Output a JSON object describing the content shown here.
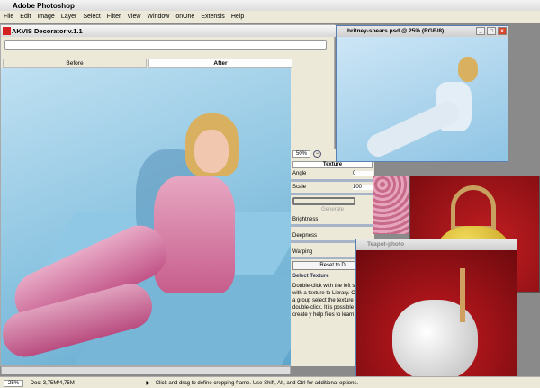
{
  "app_title": "Adobe Photoshop",
  "menu": [
    "File",
    "Edit",
    "Image",
    "Layer",
    "Select",
    "Filter",
    "View",
    "Window",
    "onOne",
    "Extensis",
    "Help"
  ],
  "plugin": {
    "title": "AKVIS Decorator v.1.1",
    "tabs": [
      "Before",
      "After"
    ],
    "zoom": "50%",
    "panel_tab": "Texture",
    "angle_label": "Angle",
    "angle_value": "0",
    "scale_label": "Scale",
    "scale_value": "100",
    "generate": "Generate",
    "brightness": "Brightness",
    "deepness": "Deepness",
    "warping": "Warping",
    "reset": "Reset to D",
    "help_title": "Select Texture",
    "help_text": "Double-click with the left square with a texture to Library. Choose a group select the texture you li double-click. It is possible to create y help files to learn how."
  },
  "doc_window": {
    "title": "britney-spears.psd @ 25% (RGB/8)"
  },
  "teapot_window": {
    "title": "Teapot-photo"
  },
  "status": {
    "zoom": "25%",
    "doc": "Doc: 3,75M/4,75M",
    "hint": "Click and drag to define cropping frame. Use Shift, Alt, and Ctrl for additional options."
  }
}
